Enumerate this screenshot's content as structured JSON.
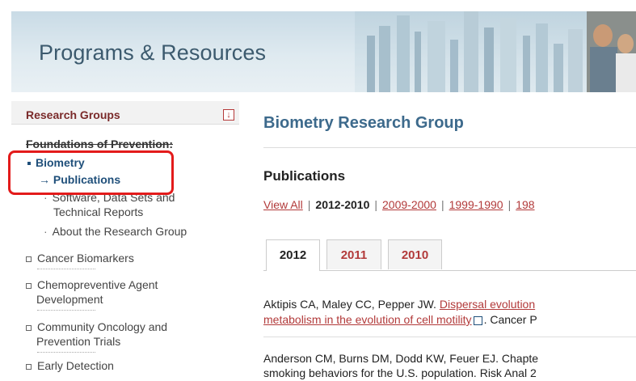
{
  "header": {
    "title": "Programs & Resources"
  },
  "sidebar": {
    "section_title": "Research Groups",
    "toggle_icon": "collapse-arrow-icon",
    "group_title": "Foundations of Prevention:",
    "items": [
      {
        "label": "Biometry"
      },
      {
        "label": "→ Publications"
      },
      {
        "label": "Software, Data Sets and"
      },
      {
        "label": "Technical Reports"
      },
      {
        "label": "About the Research Group"
      },
      {
        "label": "Cancer Biomarkers"
      },
      {
        "label": "Chemopreventive Agent"
      },
      {
        "label": "Development"
      },
      {
        "label": "Community Oncology and"
      },
      {
        "label": "Prevention Trials"
      },
      {
        "label": "Early Detection"
      }
    ]
  },
  "main": {
    "title": "Biometry Research Group",
    "section_title": "Publications",
    "year_filters": {
      "view_all": "View All",
      "current": "2012-2010",
      "range2": "2009-2000",
      "range3": "1999-1990",
      "range4": "198"
    },
    "tabs": [
      {
        "label": "2012",
        "active": true
      },
      {
        "label": "2011",
        "active": false
      },
      {
        "label": "2010",
        "active": false
      }
    ],
    "entries": [
      {
        "line1_prefix": "Aktipis CA, Maley CC, Pepper JW. ",
        "line1_link": "Dispersal evolution",
        "line2_link": "metabolism in the evolution of cell motility",
        "line2_suffix": ". Cancer P"
      },
      {
        "line1": "Anderson CM, Burns DM, Dodd KW, Feuer EJ. Chapte",
        "line2": "smoking behaviors for the U.S. population. Risk Anal 2"
      }
    ]
  },
  "colors": {
    "accent_red": "#b23a3a",
    "nav_blue": "#1f4f7a",
    "title_blue": "#3d6a8c",
    "highlight_red": "#e31b1b"
  }
}
